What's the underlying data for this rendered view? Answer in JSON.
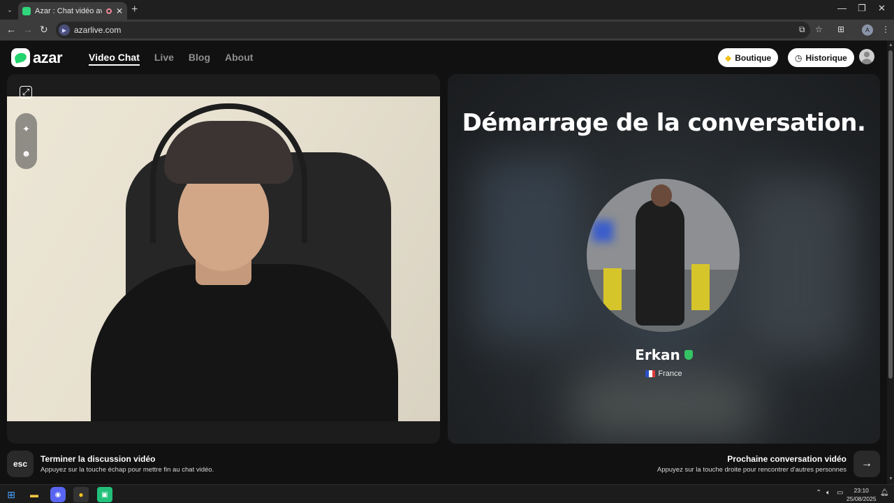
{
  "browser": {
    "tab_title": "Azar : Chat vidéo avec de n",
    "tab_close": "✕",
    "new_tab": "+",
    "url": "azarlive.com",
    "profile_initial": "A",
    "window_controls": [
      "—",
      "❐",
      "✕"
    ]
  },
  "site": {
    "logo_text": "azar",
    "nav": [
      {
        "label": "Video Chat",
        "active": true
      },
      {
        "label": "Live",
        "active": false
      },
      {
        "label": "Blog",
        "active": false
      },
      {
        "label": "About",
        "active": false
      }
    ],
    "boutique_label": "Boutique",
    "historique_label": "Historique"
  },
  "match": {
    "heading": "Démarrage de la conversation.",
    "name": "Erkan",
    "country": "France"
  },
  "footer": {
    "esc_key": "esc",
    "end_title": "Terminer la discussion vidéo",
    "end_sub": "Appuyez sur la touche échap pour mettre fin au chat vidéo.",
    "next_title": "Prochaine conversation vidéo",
    "next_sub": "Appuyez sur la touche droite pour rencontrer d'autres personnes",
    "next_arrow": "→"
  },
  "taskbar": {
    "time": "23:10",
    "date": "25/08/2025"
  },
  "colors": {
    "accent": "#22d36e",
    "verified": "#35c463",
    "background": "#111111"
  }
}
